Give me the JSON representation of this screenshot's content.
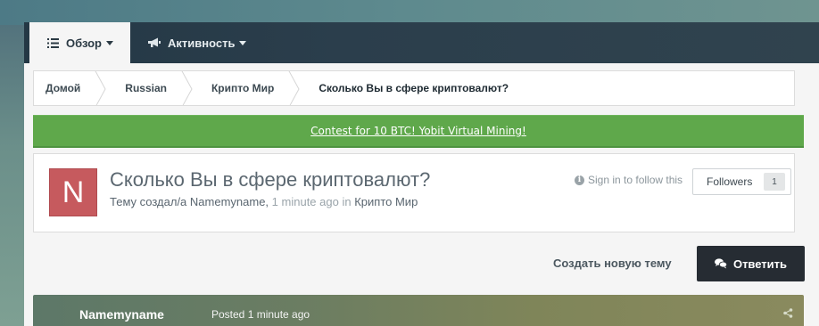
{
  "nav": {
    "tabs": [
      {
        "label": "Обзор",
        "icon": "list-icon",
        "active": true
      },
      {
        "label": "Активность",
        "icon": "megaphone-icon",
        "active": false
      }
    ]
  },
  "breadcrumb": [
    "Домой",
    "Russian",
    "Крипто Мир",
    "Сколько Вы в сфере криптовалют?"
  ],
  "promo": {
    "text": "Contest for 10 BTC! Yobit Virtual Mining!"
  },
  "topic": {
    "avatar_letter": "N",
    "title": "Сколько Вы в сфере криптовалют?",
    "meta_prefix": "Тему создал/а Namemyname,",
    "meta_time": "1 minute ago",
    "meta_in": "in",
    "meta_forum": "Крипто Мир",
    "follow_hint": "Sign in to follow this",
    "followers_label": "Followers",
    "followers_count": "1"
  },
  "actions": {
    "new_topic": "Создать новую тему",
    "reply": "Ответить"
  },
  "post": {
    "author": "Namemyname",
    "posted": "Posted 1 minute ago"
  },
  "colors": {
    "promo_bg": "#5fa84b",
    "avatar_bg": "#c65a5e",
    "reply_bg": "#262c33",
    "nav_bg": "#243845"
  }
}
